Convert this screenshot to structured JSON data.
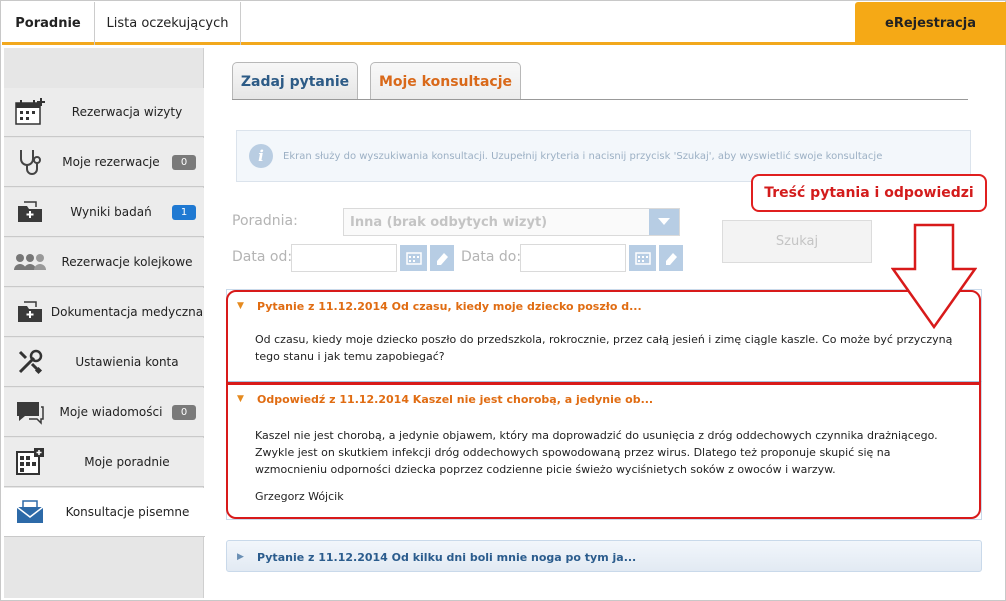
{
  "topbar": {
    "tabs": [
      "Poradnie",
      "Lista oczekujących"
    ],
    "ereg_label": "eRejestracja"
  },
  "sidebar": {
    "items": [
      {
        "label": "Rezerwacja wizyty",
        "icon": "calendar-plus-icon"
      },
      {
        "label": "Moje rezerwacje",
        "icon": "stethoscope-icon",
        "badge": "0"
      },
      {
        "label": "Wyniki badań",
        "icon": "folder-plus-icon",
        "badge": "1"
      },
      {
        "label": "Rezerwacje kolejkowe",
        "icon": "people-queue-icon"
      },
      {
        "label": "Dokumentacja medyczna",
        "icon": "folder-plus-icon"
      },
      {
        "label": "Ustawienia konta",
        "icon": "tools-icon"
      },
      {
        "label": "Moje wiadomości",
        "icon": "chat-bubble-icon",
        "badge": "0"
      },
      {
        "label": "Moje poradnie",
        "icon": "building-icon"
      },
      {
        "label": "Konsultacje pisemne",
        "icon": "envelope-icon"
      }
    ]
  },
  "main": {
    "tabs": [
      "Zadaj pytanie",
      "Moje konsultacje"
    ],
    "info_text": "Ekran służy do wyszukiwania konsultacji. Uzupełnij kryteria i nacisnij przycisk 'Szukaj', aby wyswietlić swoje konsultacje",
    "form": {
      "poradnia_label": "Poradnia:",
      "poradnia_value": "Inna (brak odbytych wizyt)",
      "date_from_label": "Data od:",
      "date_to_label": "Data do:",
      "search_label": "Szukaj"
    },
    "callout": "Treść pytania i odpowiedzi",
    "panels": {
      "question": {
        "title": "Pytanie z 11.12.2014 Od czasu, kiedy moje dziecko poszło d...",
        "body": "Od czasu, kiedy moje dziecko poszło do przedszkola, rokrocznie, przez całą jesień i zimę ciągle kaszle.  Co może być przyczyną tego stanu i jak temu zapobiegać?"
      },
      "answer": {
        "title": "Odpowiedź z 11.12.2014 Kaszel nie jest chorobą, a jedynie ob...",
        "body": "Kaszel nie jest chorobą, a jedynie objawem, który ma doprowadzić do usunięcia z dróg oddechowych czynnika drażniącego. Zwykle jest on skutkiem infekcji dróg oddechowych spowodowaną przez wirus. Dlatego też proponuje skupić się na wzmocnieniu odporności dziecka poprzez codzienne picie świeżo wyciśnietych soków z owoców i warzyw.",
        "signature": "Grzegorz Wójcik"
      },
      "question2": {
        "title": "Pytanie z 11.12.2014 Od kilku dni boli mnie noga po tym ja..."
      }
    }
  },
  "colors": {
    "accent": "#f5a916",
    "orange_text": "#e06c12",
    "blue_text": "#2b5c8d",
    "highlight_red": "#d81a1a"
  }
}
